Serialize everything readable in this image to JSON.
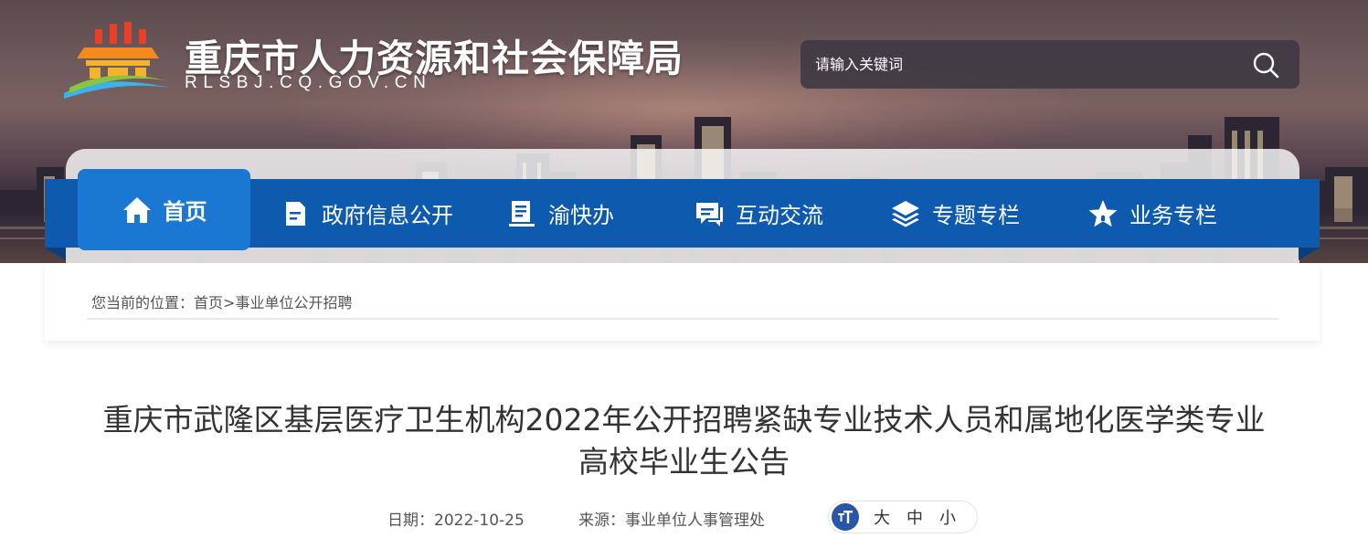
{
  "header": {
    "site_title": "重庆市人力资源和社会保障局",
    "site_domain": "RLSBJ.CQ.GOV.CN",
    "search": {
      "placeholder": "请输入关键词"
    }
  },
  "nav": {
    "items": [
      {
        "label": "首页",
        "icon": "home-icon",
        "active": true
      },
      {
        "label": "政府信息公开",
        "icon": "document-icon"
      },
      {
        "label": "渝快办",
        "icon": "service-book-icon"
      },
      {
        "label": "互动交流",
        "icon": "chat-icon"
      },
      {
        "label": "专题专栏",
        "icon": "layers-icon"
      },
      {
        "label": "业务专栏",
        "icon": "star-icon"
      }
    ]
  },
  "breadcrumb": {
    "prefix": "您当前的位置：",
    "home": "首页",
    "separator": ">",
    "current": "事业单位公开招聘"
  },
  "article": {
    "title": "重庆市武隆区基层医疗卫生机构2022年公开招聘紧缺专业技术人员和属地化医学类专业高校毕业生公告",
    "date_label": "日期：",
    "date": "2022-10-25",
    "source_label": "来源：",
    "source": "事业单位人事管理处",
    "font_size_options": [
      "大",
      "中",
      "小"
    ]
  },
  "colors": {
    "nav_bg": "#0d5aaf",
    "nav_active": "#1a78d2",
    "font_icon": "#2a56a8"
  }
}
